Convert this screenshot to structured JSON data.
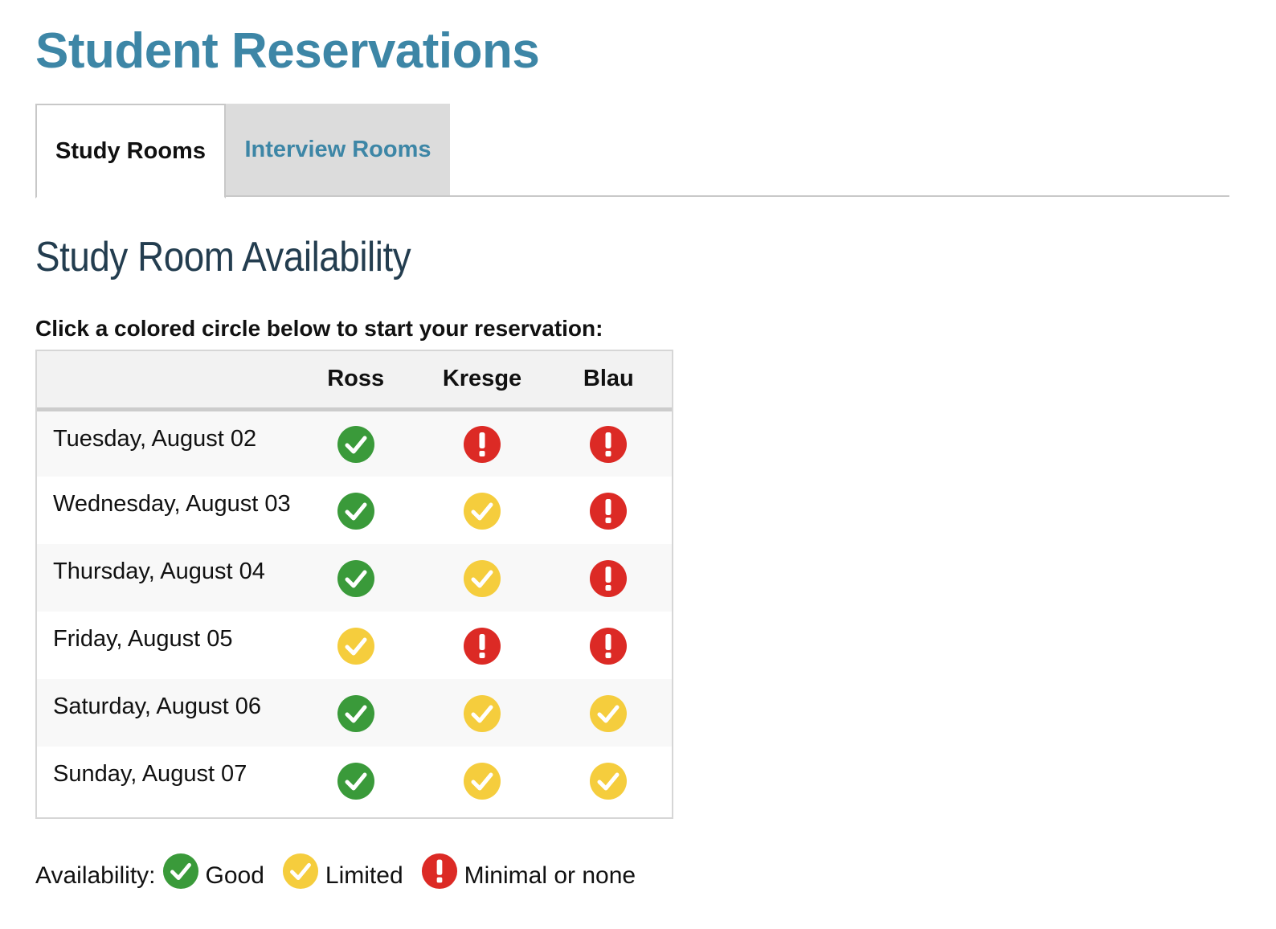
{
  "header": {
    "title": "Student Reservations"
  },
  "tabs": [
    {
      "label": "Study Rooms",
      "active": true
    },
    {
      "label": "Interview Rooms",
      "active": false
    }
  ],
  "main": {
    "section_title": "Study Room Availability",
    "instruction": "Click a colored circle below to start your reservation:",
    "table": {
      "columns": [
        "",
        "Ross",
        "Kresge",
        "Blau"
      ],
      "rows": [
        {
          "date": "Tuesday, August 02",
          "statuses": [
            "good",
            "minimal",
            "minimal"
          ]
        },
        {
          "date": "Wednesday, August 03",
          "statuses": [
            "good",
            "limited",
            "minimal"
          ]
        },
        {
          "date": "Thursday, August 04",
          "statuses": [
            "good",
            "limited",
            "minimal"
          ]
        },
        {
          "date": "Friday, August 05",
          "statuses": [
            "limited",
            "minimal",
            "minimal"
          ]
        },
        {
          "date": "Saturday, August 06",
          "statuses": [
            "good",
            "limited",
            "limited"
          ]
        },
        {
          "date": "Sunday, August 07",
          "statuses": [
            "good",
            "limited",
            "limited"
          ]
        }
      ]
    }
  },
  "legend": {
    "label": "Availability:",
    "items": [
      {
        "status": "good",
        "label": "Good",
        "icon": "check-circle-icon"
      },
      {
        "status": "limited",
        "label": "Limited",
        "icon": "check-circle-icon"
      },
      {
        "status": "minimal",
        "label": "Minimal or none",
        "icon": "exclamation-circle-icon"
      }
    ]
  },
  "colors": {
    "title": "#3d86a6",
    "section_title": "#233d4f",
    "good": "#3a9a3a",
    "limited": "#f5cd3d",
    "minimal": "#dc2a25",
    "tab_inactive_bg": "#dcdcdc"
  }
}
